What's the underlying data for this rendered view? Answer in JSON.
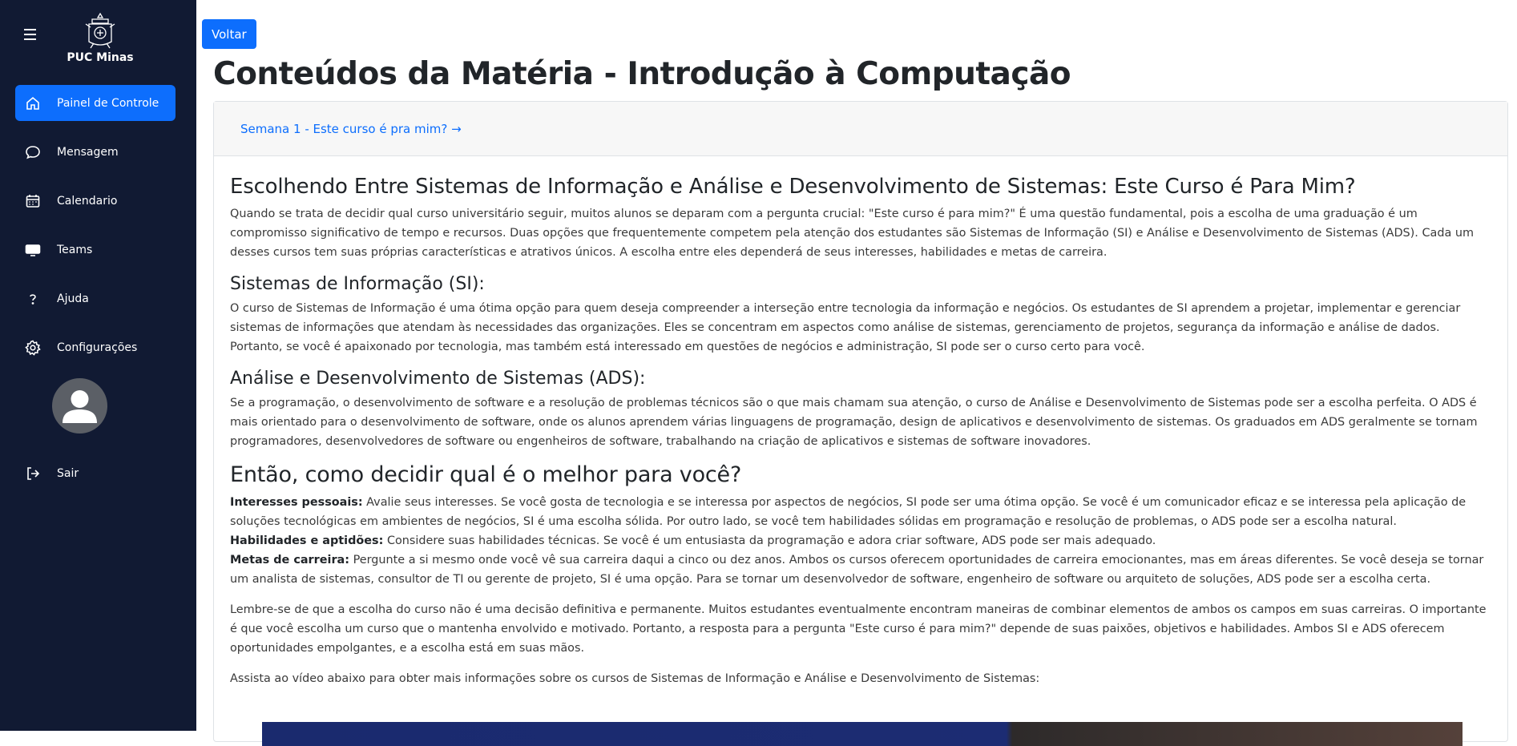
{
  "sidebar": {
    "brand": "PUC Minas",
    "items": [
      {
        "label": "Painel de Controle",
        "icon": "home-icon",
        "active": true
      },
      {
        "label": "Mensagem",
        "icon": "chat-icon",
        "active": false
      },
      {
        "label": "Calendario",
        "icon": "calendar-icon",
        "active": false
      },
      {
        "label": "Teams",
        "icon": "monitor-icon",
        "active": false
      },
      {
        "label": "Ajuda",
        "icon": "question-icon",
        "active": false
      },
      {
        "label": "Configurações",
        "icon": "gear-icon",
        "active": false
      }
    ],
    "logout": "Sair"
  },
  "main": {
    "back_label": "Voltar",
    "title": "Conteúdos da Matéria - Introdução à Computação",
    "week_link": "Semana 1 - Este curso é pra mim?",
    "article": {
      "h_main": "Escolhendo Entre Sistemas de Informação e Análise e Desenvolvimento de Sistemas: Este Curso é Para Mim?",
      "p_intro": "Quando se trata de decidir qual curso universitário seguir, muitos alunos se deparam com a pergunta crucial: \"Este curso é para mim?\" É uma questão fundamental, pois a escolha de uma graduação é um compromisso significativo de tempo e recursos. Duas opções que frequentemente competem pela atenção dos estudantes são Sistemas de Informação (SI) e Análise e Desenvolvimento de Sistemas (ADS). Cada um desses cursos tem suas próprias características e atrativos únicos. A escolha entre eles dependerá de seus interesses, habilidades e metas de carreira.",
      "h_si": "Sistemas de Informação (SI):",
      "p_si": "O curso de Sistemas de Informação é uma ótima opção para quem deseja compreender a interseção entre tecnologia da informação e negócios. Os estudantes de SI aprendem a projetar, implementar e gerenciar sistemas de informações que atendam às necessidades das organizações. Eles se concentram em aspectos como análise de sistemas, gerenciamento de projetos, segurança da informação e análise de dados. Portanto, se você é apaixonado por tecnologia, mas também está interessado em questões de negócios e administração, SI pode ser o curso certo para você.",
      "h_ads": "Análise e Desenvolvimento de Sistemas (ADS):",
      "p_ads": "Se a programação, o desenvolvimento de software e a resolução de problemas técnicos são o que mais chamam sua atenção, o curso de Análise e Desenvolvimento de Sistemas pode ser a escolha perfeita. O ADS é mais orientado para o desenvolvimento de software, onde os alunos aprendem várias linguagens de programação, design de aplicativos e desenvolvimento de sistemas. Os graduados em ADS geralmente se tornam programadores, desenvolvedores de software ou engenheiros de software, trabalhando na criação de aplicativos e sistemas de software inovadores.",
      "h_decide": "Então, como decidir qual é o melhor para você?",
      "interests_label": "Interesses pessoais:",
      "interests_text": " Avalie seus interesses. Se você gosta de tecnologia e se interessa por aspectos de negócios, SI pode ser uma ótima opção. Se você é um comunicador eficaz e se interessa pela aplicação de soluções tecnológicas em ambientes de negócios, SI é uma escolha sólida. Por outro lado, se você tem habilidades sólidas em programação e resolução de problemas, o ADS pode ser a escolha natural.",
      "skills_label": "Habilidades e aptidões:",
      "skills_text": " Considere suas habilidades técnicas. Se você é um entusiasta da programação e adora criar software, ADS pode ser mais adequado.",
      "goals_label": "Metas de carreira:",
      "goals_text": " Pergunte a si mesmo onde você vê sua carreira daqui a cinco ou dez anos. Ambos os cursos oferecem oportunidades de carreira emocionantes, mas em áreas diferentes. Se você deseja se tornar um analista de sistemas, consultor de TI ou gerente de projeto, SI é uma opção. Para se tornar um desenvolvedor de software, engenheiro de software ou arquiteto de soluções, ADS pode ser a escolha certa.",
      "p_conclusion": "Lembre-se de que a escolha do curso não é uma decisão definitiva e permanente. Muitos estudantes eventualmente encontram maneiras de combinar elementos de ambos os campos em suas carreiras. O importante é que você escolha um curso que o mantenha envolvido e motivado. Portanto, a resposta para a pergunta \"Este curso é para mim?\" depende de suas paixões, objetivos e habilidades. Ambos SI e ADS oferecem oportunidades empolgantes, e a escolha está em suas mãos.",
      "p_video": "Assista ao vídeo abaixo para obter mais informações sobre os cursos de Sistemas de Informação e Análise e Desenvolvimento de Sistemas:"
    }
  },
  "colors": {
    "sidebar_bg": "#111a33",
    "accent": "#0d6efd",
    "header_bg": "#f7f7f7"
  }
}
